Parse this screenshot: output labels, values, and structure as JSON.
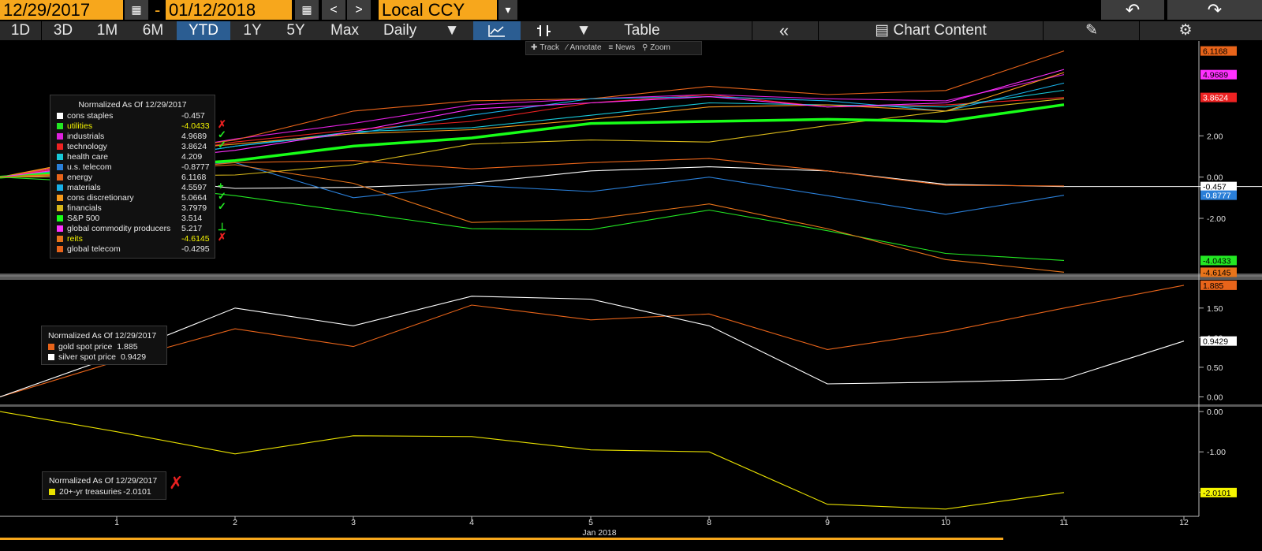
{
  "header": {
    "start_date": "12/29/2017",
    "end_date": "01/12/2018",
    "dash": "-",
    "currency": "Local CCY",
    "calendar_icon_1": "calendar-icon",
    "calendar_icon_2": "calendar-icon",
    "prev": "<",
    "next": ">",
    "dropdown": "▾",
    "undo": "↶",
    "redo": "↷"
  },
  "toolbar": {
    "ranges": [
      "1D",
      "3D",
      "1M",
      "6M",
      "YTD",
      "1Y",
      "5Y",
      "Max"
    ],
    "active_range": "YTD",
    "frequency": "Daily",
    "table": "Table",
    "collapse": "«",
    "chart_content": "Chart Content",
    "accent": "#2b5d92"
  },
  "mini_toolbar": {
    "track": "Track",
    "annotate": "Annotate",
    "news": "News",
    "zoom": "Zoom"
  },
  "chart_data": [
    {
      "type": "line",
      "panel": "sectors",
      "legend_title": "Normalized As Of 12/29/2017",
      "x_ticks": [
        "1",
        "2",
        "3",
        "4",
        "5",
        "8",
        "9",
        "10",
        "11"
      ],
      "ylim": [
        -4.6,
        6.6
      ],
      "y_ticks": [
        "2.00",
        "0.00",
        "-2.00"
      ],
      "series": [
        {
          "name": "cons staples",
          "last": "-0.457",
          "color": "#ffffff",
          "values": [
            0,
            0.05,
            -0.55,
            -0.5,
            -0.3,
            0.3,
            0.5,
            0.3,
            -0.35,
            -0.46
          ]
        },
        {
          "name": "utilities",
          "last": "-4.0433",
          "color": "#23e823",
          "values": [
            0,
            -0.3,
            -0.9,
            -1.7,
            -2.5,
            -2.55,
            -1.6,
            -2.6,
            -3.7,
            -4.04
          ]
        },
        {
          "name": "industrials",
          "last": "4.9689",
          "color": "#e020e0",
          "values": [
            0,
            0.9,
            1.85,
            2.6,
            3.5,
            3.8,
            4.0,
            3.8,
            3.7,
            4.97
          ]
        },
        {
          "name": "technology",
          "last": "3.8624",
          "color": "#ee2222",
          "values": [
            0,
            0.8,
            1.7,
            2.3,
            2.7,
            3.6,
            4.0,
            3.4,
            3.5,
            3.86
          ]
        },
        {
          "name": "health care",
          "last": "4.209",
          "color": "#18c8d8",
          "values": [
            0,
            0.6,
            1.5,
            2.2,
            2.4,
            3.0,
            3.6,
            3.5,
            3.4,
            4.21
          ]
        },
        {
          "name": "u.s. telecom",
          "last": "-0.8777",
          "color": "#2a7fd8",
          "values": [
            0,
            0.5,
            0.7,
            -1.0,
            -0.4,
            -0.7,
            0.0,
            -0.9,
            -1.8,
            -0.88
          ]
        },
        {
          "name": "energy",
          "last": "6.1168",
          "color": "#e8641a",
          "values": [
            0,
            1.0,
            1.8,
            3.2,
            3.7,
            3.8,
            4.4,
            4.0,
            4.2,
            6.12
          ]
        },
        {
          "name": "materials",
          "last": "4.5597",
          "color": "#18b0e8",
          "values": [
            0,
            0.6,
            1.5,
            2.1,
            3.0,
            3.8,
            3.9,
            3.7,
            3.2,
            4.56
          ]
        },
        {
          "name": "cons discretionary",
          "last": "5.0664",
          "color": "#f79a1a",
          "values": [
            0,
            1.1,
            1.6,
            2.1,
            2.3,
            2.8,
            3.4,
            3.5,
            3.2,
            5.07
          ]
        },
        {
          "name": "financials",
          "last": "3.7979",
          "color": "#d8b81a",
          "values": [
            0,
            0.05,
            0.1,
            0.6,
            1.6,
            1.8,
            1.7,
            2.5,
            3.2,
            3.8
          ]
        },
        {
          "name": "S&P 500",
          "last": "3.514",
          "color": "#18ff18",
          "values": [
            0,
            0.4,
            0.8,
            1.5,
            1.9,
            2.6,
            2.7,
            2.8,
            2.7,
            3.51
          ]
        },
        {
          "name": "global commodity producers",
          "last": "5.217",
          "color": "#ff30ff",
          "values": [
            0,
            0.7,
            1.3,
            2.2,
            3.3,
            3.6,
            3.9,
            3.4,
            3.6,
            5.22
          ]
        },
        {
          "name": "reits",
          "last": "-4.6145",
          "color": "#e8741a",
          "values": [
            0,
            0.3,
            0.6,
            -0.3,
            -2.2,
            -2.05,
            -1.3,
            -2.5,
            -4.0,
            -4.61
          ]
        },
        {
          "name": "global telecom",
          "last": "-0.4295",
          "color": "#e8641a",
          "values": [
            0,
            0.2,
            0.7,
            0.8,
            0.4,
            0.7,
            0.9,
            0.3,
            -0.4,
            -0.43
          ]
        }
      ],
      "end_tags": [
        {
          "text": "6.1168",
          "bg": "#e8641a",
          "fg": "#000000",
          "value": 6.1168
        },
        {
          "text": "4.9689",
          "bg": "#ff30ff",
          "fg": "#000000",
          "value": 4.9689
        },
        {
          "text": "3.8624",
          "bg": "#ee2222",
          "fg": "#ffffff",
          "value": 3.8624
        },
        {
          "text": "-0.457",
          "bg": "#ffffff",
          "fg": "#000000",
          "value": -0.457
        },
        {
          "text": "-0.8777",
          "bg": "#2a7fd8",
          "fg": "#ffffff",
          "value": -0.8777
        },
        {
          "text": "-4.0433",
          "bg": "#23e823",
          "fg": "#000000",
          "value": -4.0433
        },
        {
          "text": "-4.6145",
          "bg": "#e8741a",
          "fg": "#000000",
          "value": -4.6145
        }
      ],
      "markers": [
        {
          "row": "utilities",
          "symbol": "✗",
          "color": "#e82020"
        },
        {
          "row": "industrials",
          "symbol": "✓",
          "color": "#23e823"
        },
        {
          "row": "technology",
          "symbol": "✓",
          "color": "#23e823"
        },
        {
          "row": "materials",
          "symbol": "+",
          "color": "#23e823"
        },
        {
          "row": "cons discretionary",
          "symbol": "✓",
          "color": "#23e823"
        },
        {
          "row": "financials",
          "symbol": "✓",
          "color": "#23e823"
        },
        {
          "row": "global commodity producers",
          "symbol": "⊥",
          "color": "#23e823"
        },
        {
          "row": "reits",
          "symbol": "✗",
          "color": "#e82020"
        }
      ]
    },
    {
      "type": "line",
      "panel": "metals",
      "legend_title": "Normalized As Of 12/29/2017",
      "ylim": [
        -0.1,
        1.95
      ],
      "y_ticks": [
        "1.50",
        "1.00",
        "0.50",
        "0.00"
      ],
      "series": [
        {
          "name": "gold spot price",
          "last": "1.885",
          "color": "#e8641a",
          "values": [
            0,
            0.6,
            1.15,
            0.85,
            1.55,
            1.3,
            1.4,
            0.8,
            1.1,
            1.5,
            1.885
          ]
        },
        {
          "name": "silver spot price",
          "last": "0.9429",
          "color": "#ffffff",
          "values": [
            0,
            0.7,
            1.5,
            1.2,
            1.7,
            1.65,
            1.2,
            0.22,
            0.25,
            0.3,
            0.9429
          ]
        }
      ],
      "end_tags": [
        {
          "text": "1.885",
          "bg": "#e8641a",
          "fg": "#000000",
          "value": 1.885
        },
        {
          "text": "0.9429",
          "bg": "#ffffff",
          "fg": "#000000",
          "value": 0.9429
        }
      ]
    },
    {
      "type": "line",
      "panel": "treasuries",
      "legend_title": "Normalized As Of 12/29/2017",
      "ylim": [
        -2.6,
        0.1
      ],
      "y_ticks": [
        "0.00",
        "-1.00",
        "-2.00"
      ],
      "x_ticks": [
        "1",
        "2",
        "3",
        "4",
        "5",
        "8",
        "9",
        "10",
        "11",
        "12"
      ],
      "x_axis_label": "Jan 2018",
      "series": [
        {
          "name": "20+-yr treasuries",
          "last": "-2.0101",
          "color": "#e8e000",
          "values": [
            0,
            -0.5,
            -1.05,
            -0.6,
            -0.62,
            -0.95,
            -1.0,
            -2.3,
            -2.42,
            -2.0101
          ]
        }
      ],
      "end_tags": [
        {
          "text": "-2.0101",
          "bg": "#f5f500",
          "fg": "#000000",
          "value": -2.0101
        }
      ],
      "markers": [
        {
          "row": "20+-yr treasuries",
          "symbol": "✗",
          "color": "#e82020"
        }
      ]
    }
  ]
}
